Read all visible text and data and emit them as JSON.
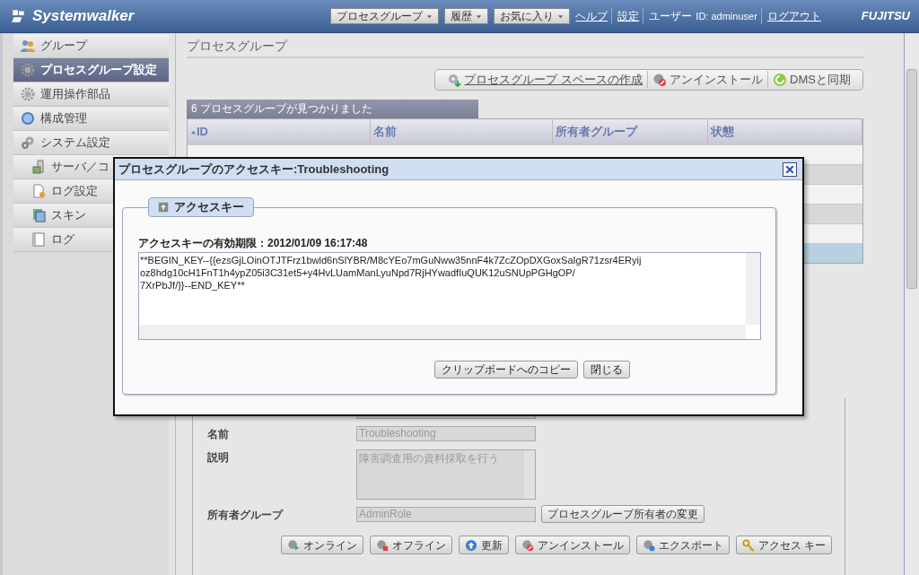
{
  "header": {
    "logo": "Systemwalker",
    "menus": [
      {
        "label": "プロセスグループ",
        "kind": "dropdown"
      },
      {
        "label": "履歴",
        "kind": "dropdown"
      },
      {
        "label": "お気に入り",
        "kind": "dropdown"
      }
    ],
    "links": [
      "ヘルプ",
      "設定"
    ],
    "user_label": "ユーザー",
    "user_id": "ID: adminuser",
    "logout": "ログアウト",
    "brand": "FUJITSU"
  },
  "sidebar": {
    "items": [
      {
        "label": "グループ",
        "selected": false
      },
      {
        "label": "プロセスグループ設定",
        "selected": true
      },
      {
        "label": "運用操作部品",
        "selected": false
      },
      {
        "label": "構成管理",
        "selected": false
      },
      {
        "label": "システム設定",
        "selected": false,
        "children": [
          {
            "label": "サーバ／コ",
            "selected": false
          },
          {
            "label": "ログ設定",
            "selected": false
          },
          {
            "label": "スキン",
            "selected": false
          },
          {
            "label": "ログ",
            "selected": false
          }
        ]
      }
    ]
  },
  "main": {
    "title": "プロセスグループ",
    "toolbar": [
      {
        "label": "プロセスグループ スペースの作成",
        "link": true
      },
      {
        "label": "アンインストール",
        "link": false
      },
      {
        "label": "DMSと同期",
        "link": false
      }
    ],
    "table": {
      "caption": "6 プロセスグループが見つかりました",
      "columns": [
        {
          "label": "ID",
          "sorted": true
        },
        {
          "label": "名前",
          "sorted": false
        },
        {
          "label": "所有者グループ",
          "sorted": false
        },
        {
          "label": "状態",
          "sorted": false
        }
      ],
      "rows": [
        {
          "selected": false
        },
        {
          "selected": false
        },
        {
          "selected": false
        },
        {
          "selected": false
        },
        {
          "selected": false
        },
        {
          "selected": true
        }
      ]
    },
    "details": {
      "fields": [
        {
          "kind": "text"
        },
        {
          "kind": "text",
          "label": "名前",
          "value": "Troubleshooting"
        },
        {
          "kind": "textarea",
          "label": "説明",
          "value": "障害調査用の資料採取を行う"
        },
        {
          "kind": "text",
          "label": "所有者グループ",
          "value": "AdminRole",
          "button": "プロセスグループ所有者の変更"
        }
      ],
      "buttons": [
        "オンライン",
        "オフライン",
        "更新",
        "アンインストール",
        "エクスポート",
        "アクセス キー"
      ]
    }
  },
  "dialog": {
    "title": "プロセスグループのアクセスキー:Troubleshooting",
    "legend": "アクセスキー",
    "expiry": "アクセスキーの有効期限：2012/01/09 16:17:48",
    "key_lines": [
      "**BEGIN_KEY--{{ezsGjLOinOTJTFrz1bwld6nSlYBR/M8cYEo7mGuNww35nnF4k7ZcZOpDXGoxSaIgR71zsr4ERyij",
      "oz8hdg10cH1FnT1h4ypZ05i3C31et5+y4HvLUamManLyuNpd7RjHYwadfIuQUK12uSNUpPGHgOP/",
      "7XrPbJf/}}--END_KEY**"
    ],
    "buttons": [
      "クリップボードへのコピー",
      "閉じる"
    ]
  }
}
